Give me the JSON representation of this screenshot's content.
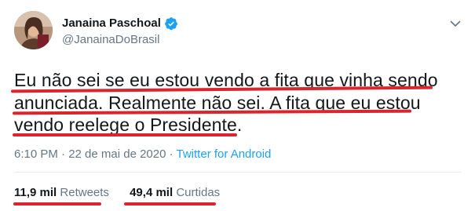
{
  "author": {
    "display_name": "Janaina Paschoal",
    "handle": "@JanainaDoBrasil",
    "verified_icon": "verified-badge-icon",
    "avatar_icon": "profile-photo"
  },
  "tweet": {
    "lines": [
      "Eu não sei se eu estou vendo a fita que vinha sendo",
      "anunciada. Realmente não sei. A fita que eu estou",
      "vendo reelege o Presidente."
    ]
  },
  "meta": {
    "time_date": "6:10 PM · 22 de mai de 2020 · ",
    "source": "Twitter for Android"
  },
  "stats": {
    "retweets_count": "11,9 mil",
    "retweets_label": "Retweets",
    "likes_count": "49,4 mil",
    "likes_label": "Curtidas"
  },
  "colors": {
    "annotation_red": "#d9262e",
    "link_blue": "#1da1f2",
    "secondary_text": "#657786"
  }
}
